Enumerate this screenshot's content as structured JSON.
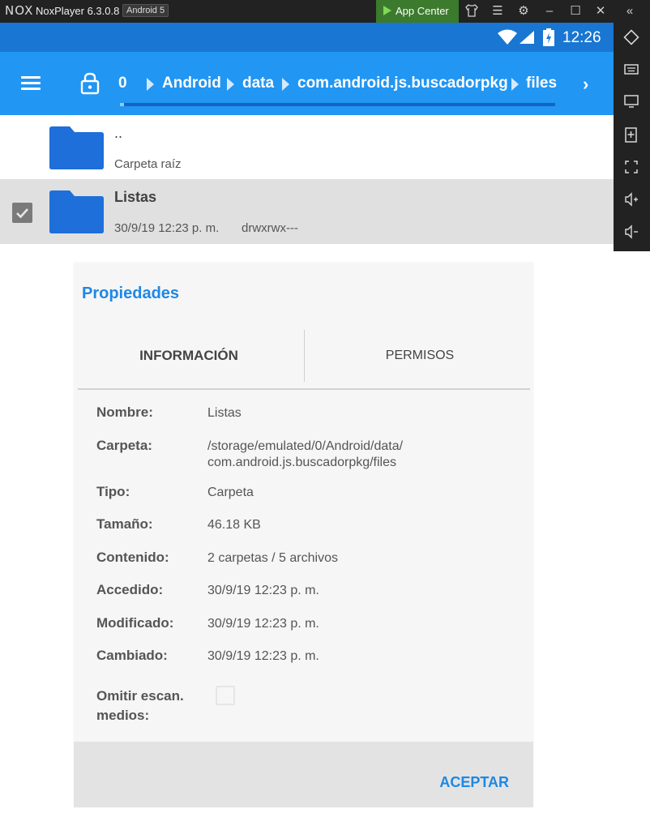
{
  "titlebar": {
    "logo": "NOX",
    "title": "NoxPlayer 6.3.0.8",
    "android_badge": "Android 5",
    "app_center": "App Center"
  },
  "statusbar": {
    "time": "12:26"
  },
  "appbar": {
    "breadcrumb": [
      "0",
      "Android",
      "data",
      "com.android.js.buscadorpkg",
      "files"
    ]
  },
  "file_list": {
    "parent": {
      "name": "..",
      "subtitle": "Carpeta raíz"
    },
    "selected": {
      "name": "Listas",
      "date": "30/9/19 12:23 p. m.",
      "permissions": "drwxrwx---"
    }
  },
  "dialog": {
    "title": "Propiedades",
    "tabs": {
      "info": "INFORMACIÓN",
      "permissions": "PERMISOS"
    },
    "properties": [
      {
        "label": "Nombre:",
        "value": "Listas"
      },
      {
        "label": "Carpeta:",
        "value": "/storage/emulated/0/Android/data/",
        "value2": "com.android.js.buscadorpkg/files"
      },
      {
        "label": "Tipo:",
        "value": "Carpeta"
      },
      {
        "label": "Tamaño:",
        "value": "46.18 KB"
      },
      {
        "label": "Contenido:",
        "value": "2 carpetas / 5 archivos"
      },
      {
        "label": "Accedido:",
        "value": "30/9/19 12:23 p. m."
      },
      {
        "label": "Modificado:",
        "value": "30/9/19 12:23 p. m."
      },
      {
        "label": "Cambiado:",
        "value": "30/9/19 12:23 p. m."
      }
    ],
    "omit_scan": {
      "label_line1": "Omitir escan.",
      "label_line2": "medios:",
      "checked": false
    },
    "accept_button": "ACEPTAR"
  },
  "colors": {
    "statusbar": "#1976d2",
    "appbar": "#2196f3",
    "accent": "#1e88e5",
    "folder": "#1e6fd9",
    "selected_row": "#e0e0e0"
  }
}
